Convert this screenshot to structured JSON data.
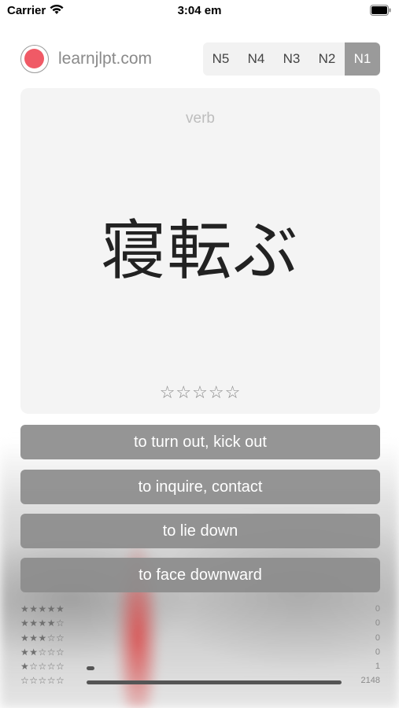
{
  "status_bar": {
    "carrier": "Carrier",
    "time": "3:04 em"
  },
  "header": {
    "site": "learnjlpt.com",
    "levels": [
      "N5",
      "N4",
      "N3",
      "N2",
      "N1"
    ],
    "active_level": "N1"
  },
  "card": {
    "part_of_speech": "verb",
    "word": "寝転ぶ",
    "rating_stars": "☆☆☆☆☆"
  },
  "answers": [
    "to turn out, kick out",
    "to inquire, contact",
    "to lie down",
    "to face downward"
  ],
  "stats": [
    {
      "stars": "★★★★★",
      "count": "0",
      "fraction": 0
    },
    {
      "stars": "★★★★☆",
      "count": "0",
      "fraction": 0
    },
    {
      "stars": "★★★☆☆",
      "count": "0",
      "fraction": 0
    },
    {
      "stars": "★★☆☆☆",
      "count": "0",
      "fraction": 0
    },
    {
      "stars": "★☆☆☆☆",
      "count": "1",
      "fraction": 0.03
    },
    {
      "stars": "☆☆☆☆☆",
      "count": "2148",
      "fraction": 1
    }
  ],
  "colors": {
    "record_dot": "#f05a66",
    "active_level_bg": "#9a9a9a",
    "answer_bg": "#8c8c8c"
  }
}
